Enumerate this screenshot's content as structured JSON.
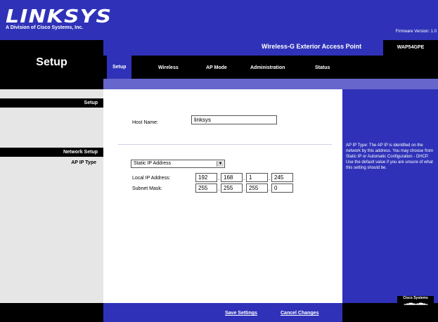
{
  "header": {
    "logo_text": "LINKSYS",
    "logo_subtitle": "A Division of Cisco Systems, Inc.",
    "firmware_label": "Firmware Version: 1.0"
  },
  "product": {
    "name": "Wireless-G Exterior Access Point",
    "model": "WAP54GPE"
  },
  "page_title": "Setup",
  "tabs": [
    {
      "label": "Setup",
      "active": true
    },
    {
      "label": "Wireless"
    },
    {
      "label": "AP Mode"
    },
    {
      "label": "Administration"
    },
    {
      "label": "Status"
    }
  ],
  "left_sections": {
    "setup": "Setup",
    "network_setup": "Network Setup",
    "ap_ip_type": "AP IP Type"
  },
  "form": {
    "host_name_label": "Host Name:",
    "host_name_value": "linksys",
    "ip_type_selected": "Static IP Address",
    "local_ip_label": "Local IP Address:",
    "local_ip": [
      "192",
      "168",
      "1",
      "245"
    ],
    "subnet_label": "Subnet Mask:",
    "subnet": [
      "255",
      "255",
      "255",
      "0"
    ]
  },
  "help_text": "AP IP Type: The AP IP is identified on the network by this address. You may choose from Static IP or Automatic Configuration - DHCP. Use the default value if you are unsure of what this setting should be.",
  "footer": {
    "save_label": "Save Settings",
    "cancel_label": "Cancel Changes",
    "cisco_label": "Cisco Systems"
  },
  "colors": {
    "brand_blue": "#2f32b8",
    "tab_band": "#6666cc"
  }
}
